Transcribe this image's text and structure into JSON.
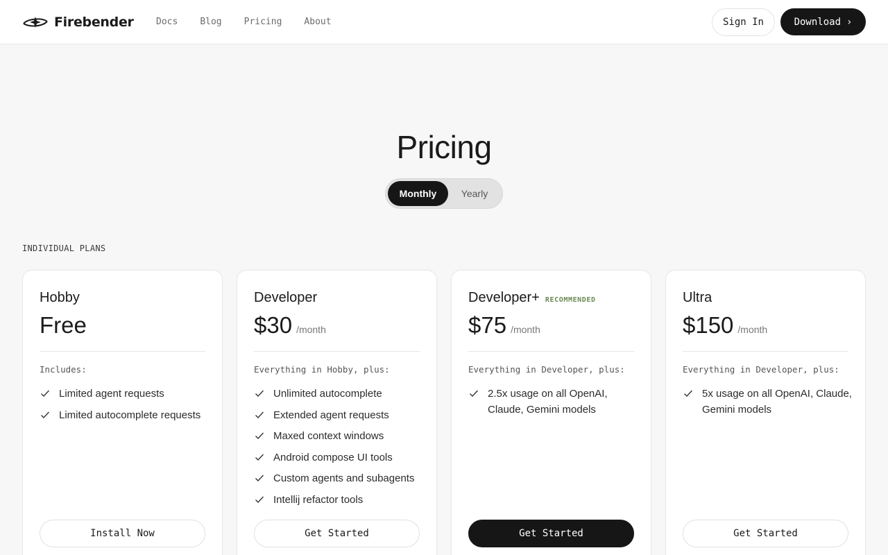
{
  "header": {
    "brand": "Firebender",
    "nav": [
      "Docs",
      "Blog",
      "Pricing",
      "About"
    ],
    "sign_in": "Sign In",
    "download": "Download"
  },
  "hero": {
    "title": "Pricing",
    "toggle": {
      "monthly": "Monthly",
      "yearly": "Yearly",
      "selected": "Monthly"
    }
  },
  "section_label": "INDIVIDUAL PLANS",
  "plans": [
    {
      "name": "Hobby",
      "badge": "",
      "price": "Free",
      "unit": "",
      "includes": "Includes:",
      "features": [
        "Limited agent requests",
        "Limited autocomplete requests"
      ],
      "cta": "Install Now"
    },
    {
      "name": "Developer",
      "badge": "",
      "price": "$30",
      "unit": "/month",
      "includes": "Everything in Hobby, plus:",
      "features": [
        "Unlimited autocomplete",
        "Extended agent requests",
        "Maxed context windows",
        "Android compose UI tools",
        "Custom agents and subagents",
        "Intellij refactor tools"
      ],
      "cta": "Get Started"
    },
    {
      "name": "Developer+",
      "badge": "RECOMMENDED",
      "price": "$75",
      "unit": "/month",
      "includes": "Everything in Developer, plus:",
      "features": [
        "2.5x usage on all OpenAI, Claude, Gemini models"
      ],
      "cta": "Get Started"
    },
    {
      "name": "Ultra",
      "badge": "",
      "price": "$150",
      "unit": "/month",
      "includes": "Everything in Developer, plus:",
      "features": [
        "5x usage on all OpenAI, Claude, Gemini models"
      ],
      "cta": "Get Started"
    }
  ]
}
